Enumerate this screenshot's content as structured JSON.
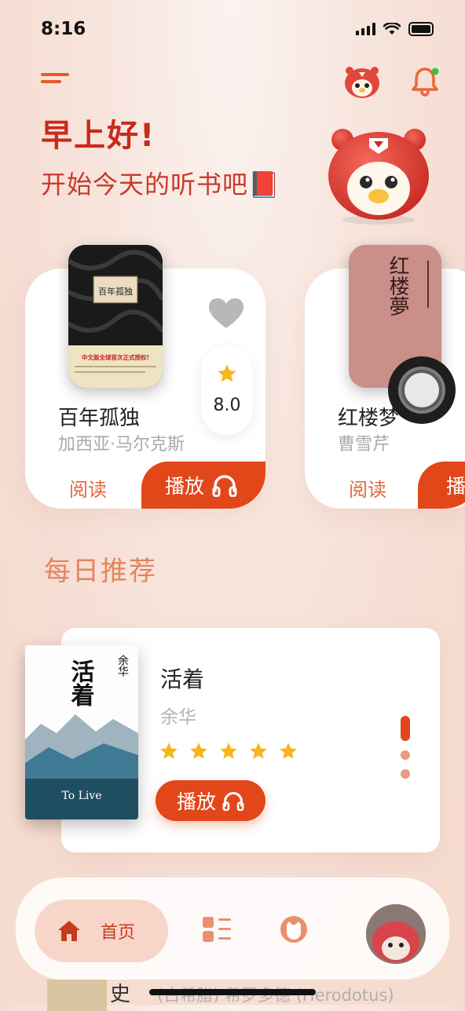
{
  "status": {
    "time": "8:16"
  },
  "header": {
    "greeting": "早上好!",
    "subtitle": "开始今天的听书吧📕"
  },
  "books": [
    {
      "title": "百年孤独",
      "author": "加西亚·马尔克斯",
      "rating": "8.0",
      "read_label": "阅读",
      "play_label": "播放",
      "cover_title": "百年孤独",
      "cover_banner": "中文版全球首次正式授权!"
    },
    {
      "title": "红楼梦",
      "author": "曹雪芹",
      "read_label": "阅读",
      "play_label": "播",
      "cover_title": "红楼夢"
    }
  ],
  "daily": {
    "section_title": "每日推荐",
    "title": "活着",
    "author": "余华",
    "stars": 5,
    "play_label": "播放",
    "cover_title": "活着",
    "cover_author": "余华",
    "cover_en": "To Live"
  },
  "nav": {
    "home_label": "首页"
  },
  "peek": {
    "title": "史",
    "author": "(古希腊) 希罗多德 (Herodotus)"
  },
  "colors": {
    "accent": "#e2471a",
    "greeting": "#c92a1a",
    "section": "#e7835c"
  }
}
